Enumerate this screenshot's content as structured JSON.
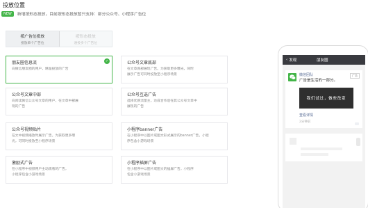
{
  "section": {
    "title": "投放位置"
  },
  "notice": {
    "badge": "NEW",
    "text": "新增按形态投放，目前按形态投放暂只支持：部分公众号、小程序广告位"
  },
  "tabs": [
    {
      "title": "按广告位投放",
      "sub": "投放单个广告位",
      "active": true
    },
    {
      "title": "按形态投放",
      "sub": "通投多个广告位",
      "active": false
    }
  ],
  "placements": [
    {
      "title": "朋友圈信息流",
      "desc": [
        "向微信朋友圈的用户，精准投放的广告"
      ],
      "selected": true
    },
    {
      "title": "公众号文章底部",
      "desc": [
        "在文章底部展现广告。为获取更多曝光，同时",
        "展示广告可同时投放至小程序场景"
      ],
      "selected": false
    },
    {
      "title": "公众号文章中部",
      "desc": [
        "向阅读微信公众号文章的用户，在文章中部展",
        "现的广告"
      ],
      "selected": false
    },
    {
      "title": "公众号互选广告",
      "desc": [
        "选择优质流量主，达成合作后在其公众号文章中",
        "展现的广告"
      ],
      "selected": false
    },
    {
      "title": "公众号视频贴片",
      "desc": [
        "在文中视频播放时展示广告。为获取更多曝",
        "光，可同时投放至小程序场景"
      ],
      "selected": false
    },
    {
      "title": "小程序banner广告",
      "desc": [
        "在小程序中以图片或图文形式展示的banner广告，小程",
        "序包含小游戏场景"
      ],
      "selected": false
    },
    {
      "title": "激励式广告",
      "desc": [
        "在小程序中视频用户主动观看的广告，",
        "小程序包含小游戏场景"
      ],
      "selected": false
    },
    {
      "title": "小程序插屏广告",
      "desc": [
        "在小程序中以图片或图文的插屏广告，小程序",
        "包含小游戏场景"
      ],
      "selected": false
    }
  ],
  "preview": {
    "back_label": "发现",
    "title": "朋友圈",
    "account_name": "微信团队",
    "ad_copy": "广告是生活的一部分。",
    "ad_tag": "广告",
    "image_text": "我们试过，做些改变",
    "link": "查看详情",
    "time": "2分钟前"
  },
  "colors": {
    "accent": "#44b549",
    "link": "#576b95",
    "header": "#393a3f"
  }
}
